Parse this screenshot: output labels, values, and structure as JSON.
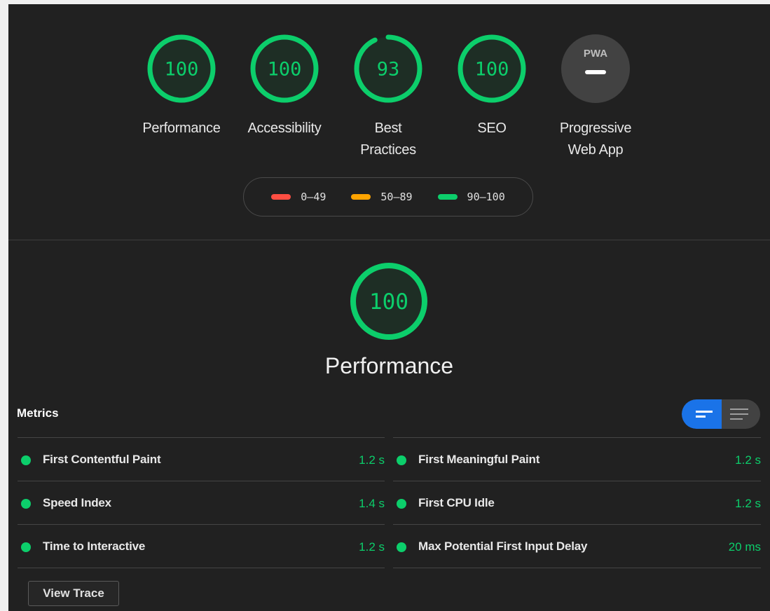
{
  "colors": {
    "pass": "#0cce6b",
    "average": "#ffa400",
    "fail": "#ff4e42",
    "gauge_bg": "#1e3a2a",
    "pwa_bg": "#424242",
    "toggle_active": "#1a73e8"
  },
  "categories": [
    {
      "label": "Performance",
      "score": "100",
      "fraction": 1.0
    },
    {
      "label": "Accessibility",
      "score": "100",
      "fraction": 1.0
    },
    {
      "label": "Best Practices",
      "score": "93",
      "fraction": 0.93
    },
    {
      "label": "SEO",
      "score": "100",
      "fraction": 1.0
    }
  ],
  "pwa": {
    "badge": "PWA",
    "label": "Progressive Web App"
  },
  "legend": [
    {
      "range": "0–49",
      "color": "#ff4e42"
    },
    {
      "range": "50–89",
      "color": "#ffa400"
    },
    {
      "range": "90–100",
      "color": "#0cce6b"
    }
  ],
  "performance": {
    "score": "100",
    "fraction": 1.0,
    "title": "Performance",
    "metrics_title": "Metrics",
    "view_trace_label": "View Trace",
    "metrics_left": [
      {
        "name": "First Contentful Paint",
        "value": "1.2 s"
      },
      {
        "name": "Speed Index",
        "value": "1.4 s"
      },
      {
        "name": "Time to Interactive",
        "value": "1.2 s"
      }
    ],
    "metrics_right": [
      {
        "name": "First Meaningful Paint",
        "value": "1.2 s"
      },
      {
        "name": "First CPU Idle",
        "value": "1.2 s"
      },
      {
        "name": "Max Potential First Input Delay",
        "value": "20 ms"
      }
    ]
  }
}
